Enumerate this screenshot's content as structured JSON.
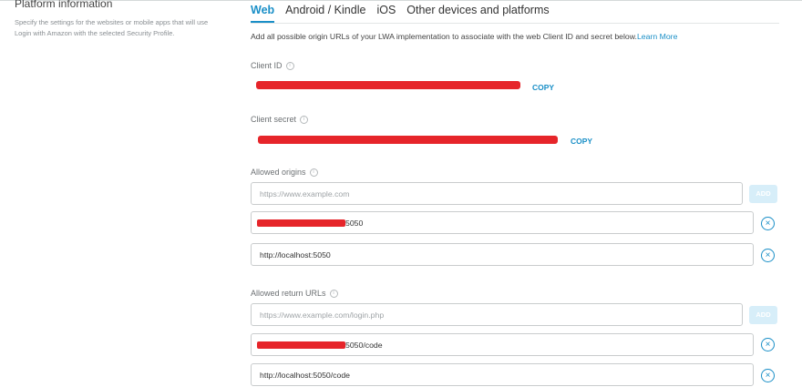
{
  "platform": {
    "heading": "Platform information",
    "description_line1": "Specify the settings for the websites or mobile apps that will use",
    "description_line2": "Login with Amazon with the selected Security Profile."
  },
  "tabs": [
    {
      "label": "Web",
      "active": true
    },
    {
      "label": "Android / Kindle",
      "active": false
    },
    {
      "label": "iOS",
      "active": false
    },
    {
      "label": "Other devices and platforms",
      "active": false
    }
  ],
  "web": {
    "description": "Add all possible origin URLs of your LWA implementation to associate with the web Client ID and secret below.",
    "learn_more": "Learn More",
    "client_id_label": "Client ID",
    "client_secret_label": "Client secret",
    "copy_label": "COPY",
    "allowed_origins_label": "Allowed origins",
    "origins_placeholder": "https://www.example.com",
    "add_label": "ADD",
    "origins": [
      "5050",
      "http://localhost:5050"
    ],
    "allowed_return_urls_label": "Allowed return URLs",
    "return_placeholder": "https://www.example.com/login.php",
    "return_urls": [
      "5050/code",
      "http://localhost:5050/code"
    ]
  },
  "colors": {
    "accent": "#1a8fc7",
    "redaction": "#e6252a"
  },
  "icons": {
    "info": "info-icon",
    "remove": "remove-circle-icon"
  }
}
